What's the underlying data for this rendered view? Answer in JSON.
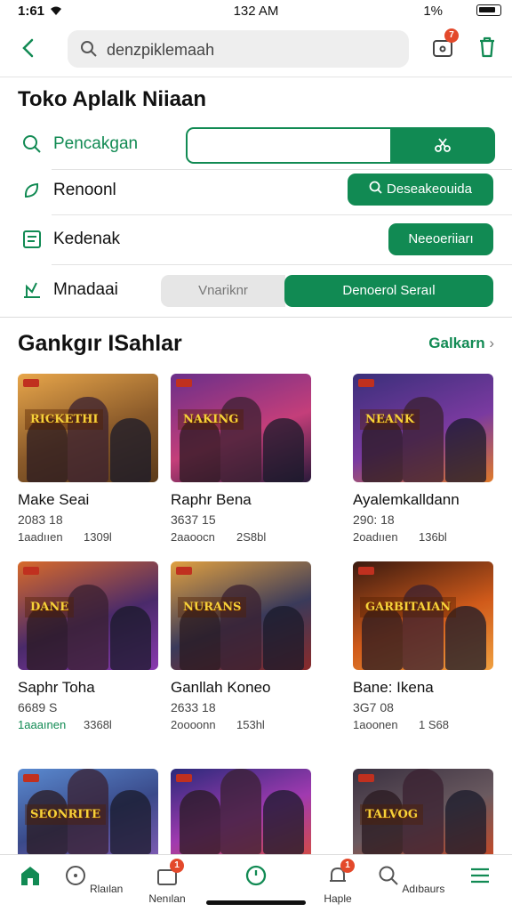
{
  "status": {
    "time": "1:61",
    "center": "132 AM",
    "right": "1%"
  },
  "search": {
    "placeholder": "denzpiklemaah"
  },
  "header": {
    "cart_badge": "7"
  },
  "store": {
    "title": "Toko Aplalk  Niiaan",
    "rows": [
      {
        "label": "Pencakgan",
        "button": "",
        "icon": "search-icon"
      },
      {
        "label": "Renoonl",
        "button": "Deseakeouida",
        "icon": "leaf-icon"
      },
      {
        "label": "Kedenak",
        "button": "Neeoeriiarı",
        "icon": "list-icon"
      },
      {
        "label": "Mnadaai",
        "button_secondary": "Vnariknr",
        "button": "Denoerol Seraıl",
        "icon": "chart-icon"
      }
    ]
  },
  "games": {
    "title": "Gankgır ISahlar",
    "see_all": "Galkarn",
    "items": [
      {
        "name": "Make Seai",
        "sub": "2083 18",
        "meta_a": "1aadııen",
        "meta_b": "1309l",
        "banner": "RICKETHI"
      },
      {
        "name": "Raphr Bena",
        "sub": "3637 15",
        "meta_a": "2aaoocn",
        "meta_b": "2S8bl",
        "banner": "NAKING"
      },
      {
        "name": "Ayalemkalldann",
        "sub": "290: 18",
        "meta_a": "2oadııen",
        "meta_b": "136bl",
        "banner": "NEANK"
      },
      {
        "name": "Saphr Toha",
        "sub": "6689 S",
        "meta_a": "1aaaınen",
        "meta_b": "3368l",
        "banner": "DANE"
      },
      {
        "name": "Ganllah Koneo",
        "sub": "2633 18",
        "meta_a": "2oooonn",
        "meta_b": "153hl",
        "banner": "NURANS"
      },
      {
        "name": "Bane: Ikena",
        "sub": "3G7 08",
        "meta_a": "1aoonen",
        "meta_b": "1 S68",
        "banner": "GARBITAIAN"
      },
      {
        "name": "",
        "sub": "",
        "meta_a": "",
        "meta_b": "",
        "banner": "SEONRITE"
      },
      {
        "name": "",
        "sub": "",
        "meta_a": "",
        "meta_b": "",
        "banner": ""
      },
      {
        "name": "",
        "sub": "",
        "meta_a": "",
        "meta_b": "",
        "banner": "TALVOG"
      }
    ]
  },
  "tabbar": {
    "items": [
      {
        "label": "",
        "icon": "home-icon"
      },
      {
        "label": "Rlaılan",
        "icon": "compass-icon"
      },
      {
        "label": "Nenılan",
        "icon": "bag-icon",
        "badge": "1"
      },
      {
        "label": "",
        "icon": "timer-icon"
      },
      {
        "label": "Haple",
        "icon": "bell-icon",
        "badge": "1"
      },
      {
        "label": "Adıbaurs",
        "icon": "search-icon"
      },
      {
        "label": "",
        "icon": "menu-icon"
      }
    ]
  },
  "colors": {
    "accent": "#118a53",
    "badge": "#e3492b"
  }
}
